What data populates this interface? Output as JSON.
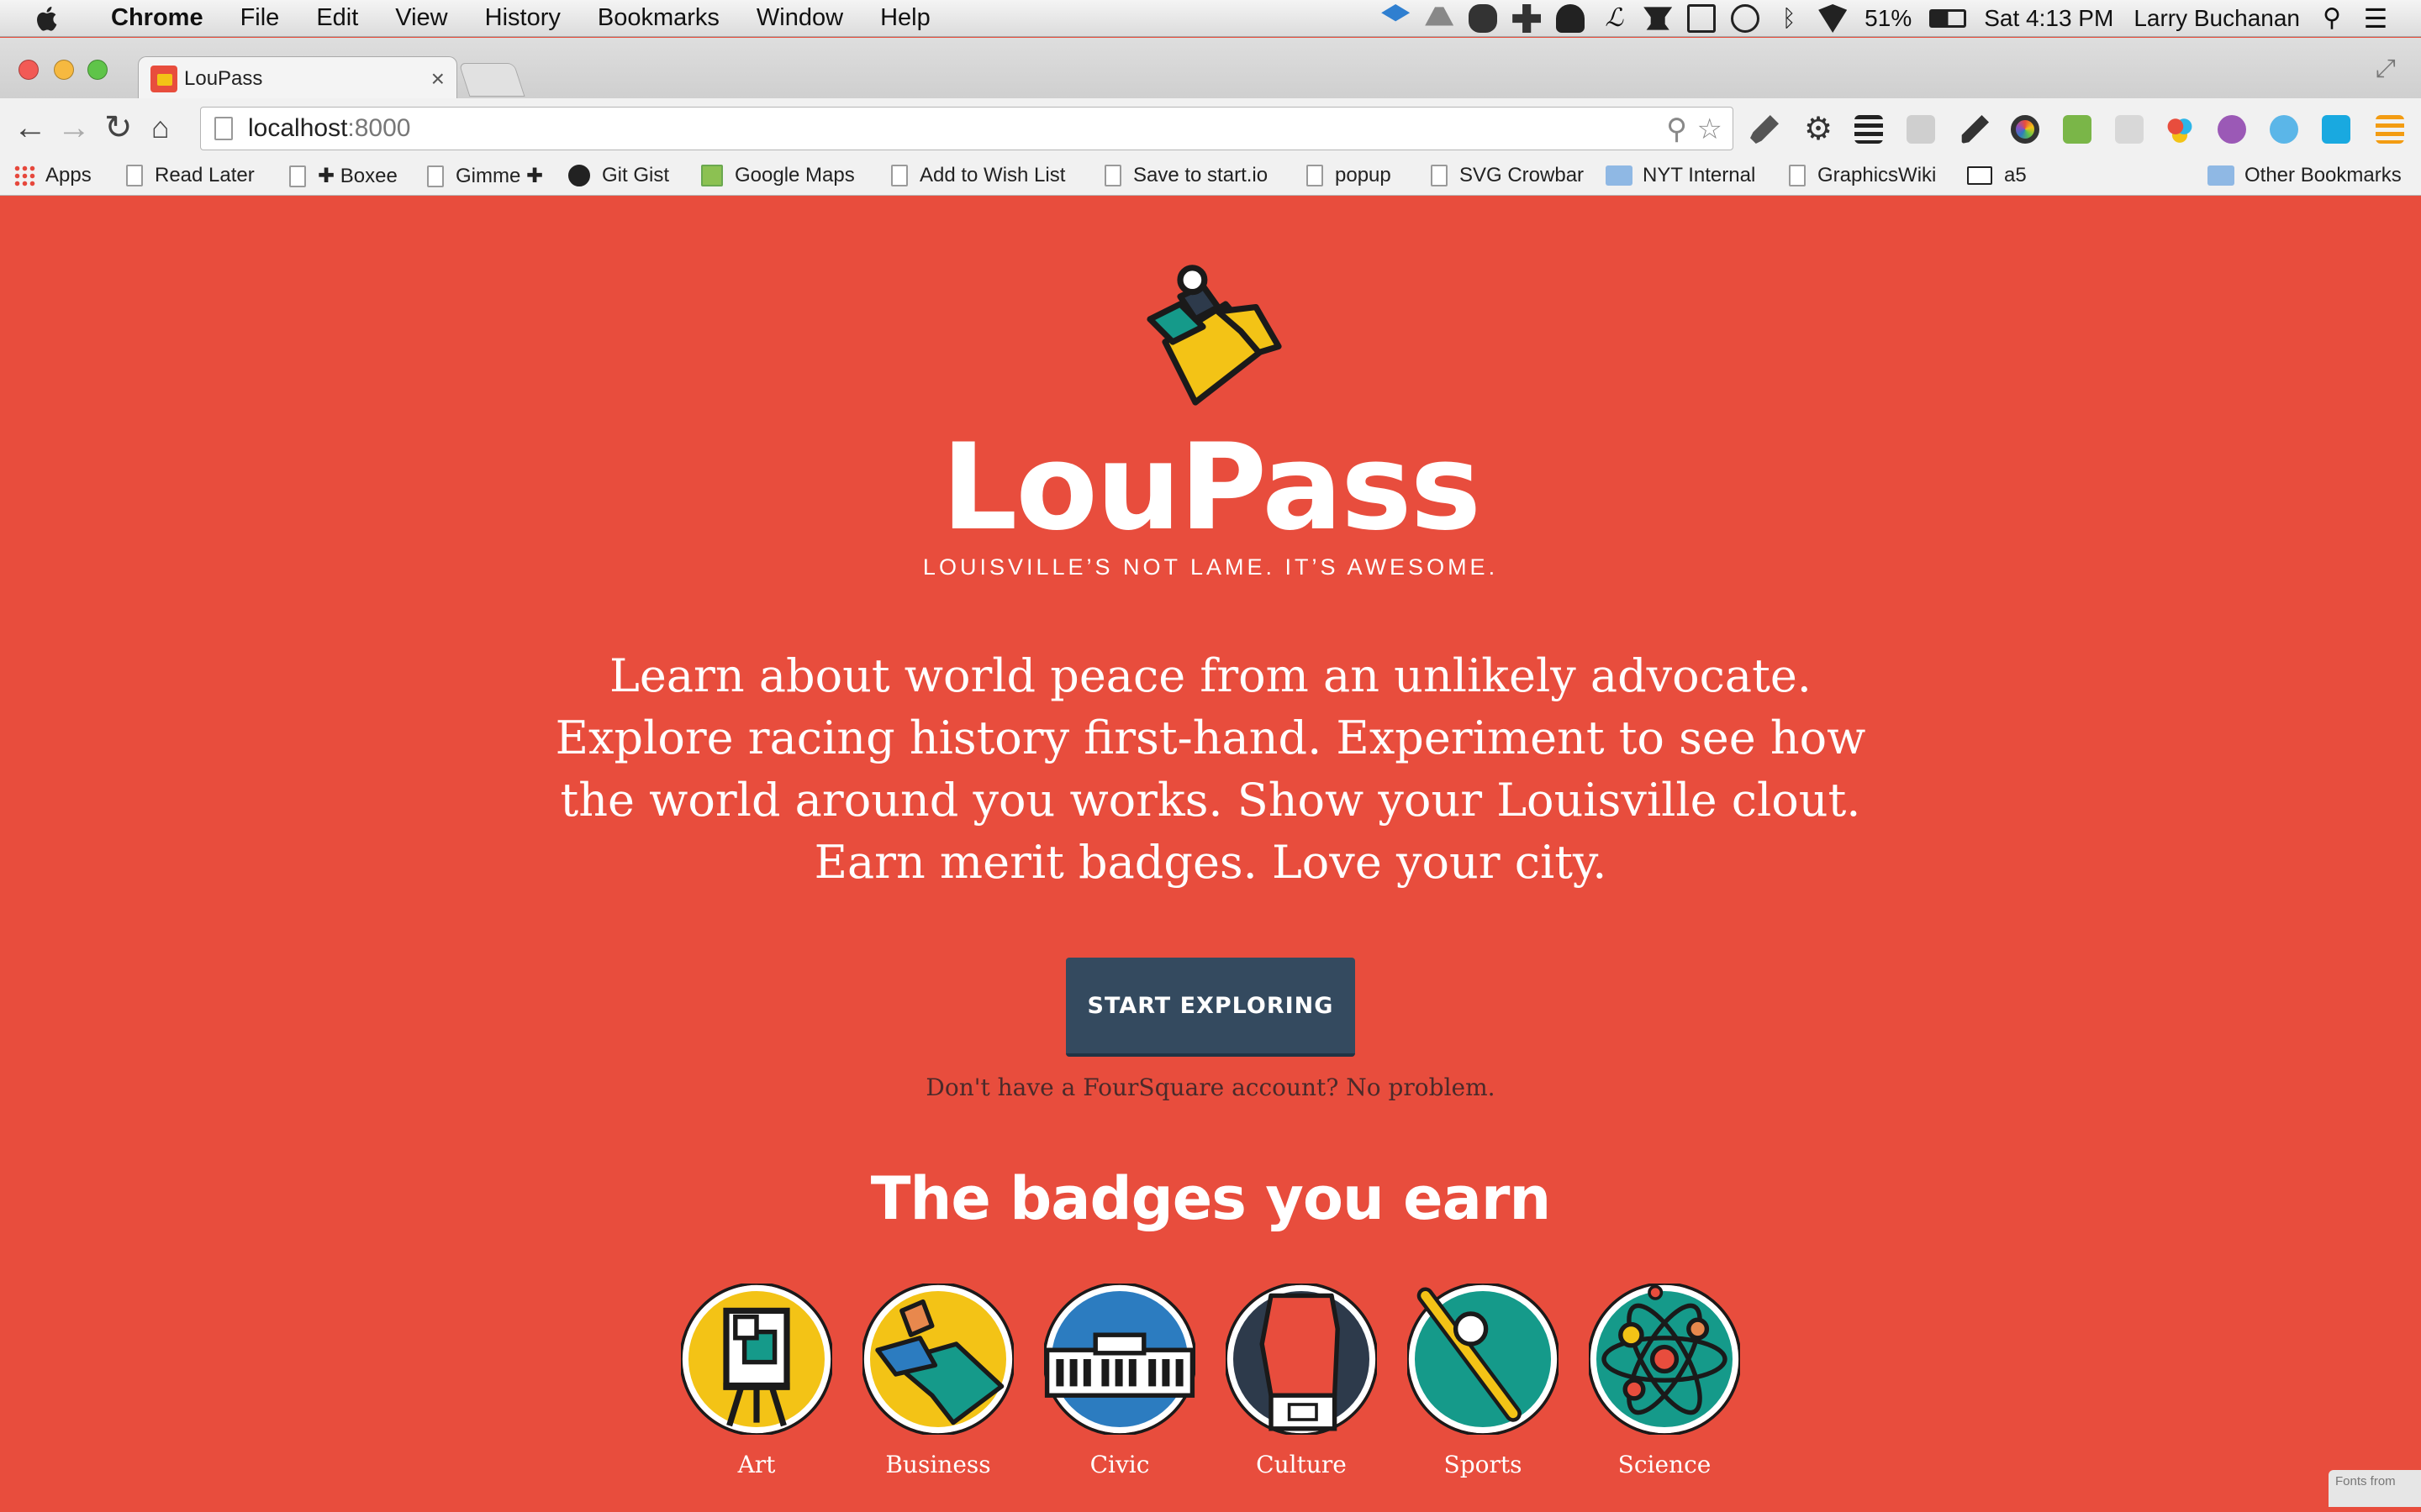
{
  "menubar": {
    "app": "Chrome",
    "items": [
      "File",
      "Edit",
      "View",
      "History",
      "Bookmarks",
      "Window",
      "Help"
    ],
    "battery": "51%",
    "clock": "Sat 4:13 PM",
    "user": "Larry Buchanan"
  },
  "tab": {
    "title": "LouPass",
    "close": "×"
  },
  "omnibox": {
    "host": "localhost",
    "port": ":8000"
  },
  "bookmarks": {
    "apps": "Apps",
    "items": [
      "Read Later",
      "✚ Boxee",
      "Gimme ✚",
      "Git Gist",
      "Google Maps",
      "Add to Wish List",
      "Save to start.io",
      "popup",
      "SVG Crowbar",
      "NYT Internal",
      "GraphicsWiki",
      "a5"
    ],
    "other": "Other Bookmarks"
  },
  "page": {
    "title": "LouPass",
    "tagline": "LOUISVILLE’S NOT LAME. IT’S AWESOME.",
    "intro": "Learn about world peace from an unlikely advocate. Explore racing history first-hand. Experiment to see how the world around you works. Show your Louisville clout. Earn merit badges. Love your city.",
    "cta": "START EXPLORING",
    "note": "Don't have a FourSquare account? No problem.",
    "badges_heading": "The badges you earn",
    "badges": [
      "Art",
      "Business",
      "Civic",
      "Culture",
      "Sports",
      "Science"
    ],
    "fonts_badge": "Fonts from"
  },
  "colors": {
    "page_bg": "#e84d3d",
    "button": "#344a5f",
    "badge_yellow": "#f3c316",
    "badge_teal": "#159a8a",
    "badge_blue": "#2c7cc0",
    "badge_navy": "#2d3a4b"
  }
}
